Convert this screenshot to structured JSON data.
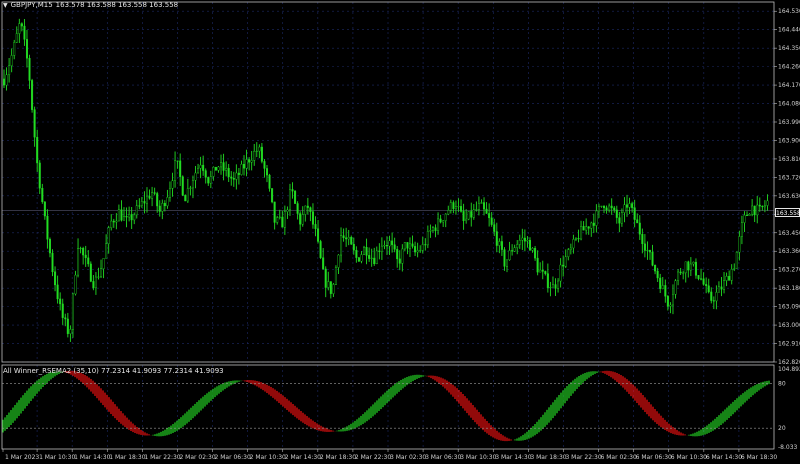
{
  "header": {
    "symbol": "GBPJPY,M15",
    "quote": "163.578 163.588 163.558 163.558"
  },
  "indicator": {
    "title": "All Winner_RSEMA2 (35,10) 77.2314 41.9093 77.2314 41.9093",
    "axis_labels": {
      "top": "104.892",
      "upper": "80",
      "lower": "20",
      "bottom": "-8.033"
    },
    "colors": {
      "bull": "#22cc22",
      "bear": "#e01010"
    }
  },
  "price_axis": {
    "ticks": [
      "164.530",
      "164.440",
      "164.350",
      "164.260",
      "164.170",
      "164.080",
      "163.990",
      "163.900",
      "163.810",
      "163.720",
      "163.630",
      "163.540",
      "163.450",
      "163.360",
      "163.270",
      "163.180",
      "163.090",
      "163.000",
      "162.910",
      "162.820"
    ],
    "current": "163.558"
  },
  "time_axis": {
    "ticks": [
      "1 Mar 2023",
      "1 Mar 10:30",
      "1 Mar 14:30",
      "1 Mar 18:30",
      "1 Mar 22:30",
      "2 Mar 02:30",
      "2 Mar 06:30",
      "2 Mar 10:30",
      "2 Mar 14:30",
      "2 Mar 18:30",
      "2 Mar 22:30",
      "3 Mar 02:30",
      "3 Mar 06:30",
      "3 Mar 10:30",
      "3 Mar 14:30",
      "3 Mar 18:30",
      "3 Mar 22:30",
      "6 Mar 02:30",
      "6 Mar 06:30",
      "6 Mar 10:30",
      "6 Mar 14:30",
      "6 Mar 18:30"
    ]
  },
  "chart_data": {
    "type": "candlestick",
    "ylim": [
      162.82,
      164.575
    ],
    "closes": [
      164.2,
      164.32,
      164.48,
      164.25,
      163.8,
      163.5,
      163.25,
      163.05,
      162.95,
      163.4,
      163.3,
      163.2,
      163.3,
      163.5,
      163.55,
      163.5,
      163.55,
      163.6,
      163.65,
      163.55,
      163.65,
      163.8,
      163.62,
      163.72,
      163.8,
      163.7,
      163.78,
      163.75,
      163.7,
      163.76,
      163.82,
      163.86,
      163.72,
      163.5,
      163.5,
      163.66,
      163.5,
      163.58,
      163.44,
      163.22,
      163.16,
      163.44,
      163.4,
      163.32,
      163.38,
      163.32,
      163.4,
      163.4,
      163.3,
      163.4,
      163.35,
      163.38,
      163.46,
      163.5,
      163.56,
      163.6,
      163.5,
      163.54,
      163.58,
      163.52,
      163.42,
      163.3,
      163.38,
      163.42,
      163.4,
      163.28,
      163.22,
      163.18,
      163.3,
      163.36,
      163.44,
      163.48,
      163.52,
      163.6,
      163.56,
      163.5,
      163.6,
      163.5,
      163.4,
      163.3,
      163.2,
      163.1,
      163.24,
      163.3,
      163.28,
      163.22,
      163.12,
      163.16,
      163.22,
      163.3,
      163.5,
      163.58,
      163.55,
      163.6
    ]
  }
}
